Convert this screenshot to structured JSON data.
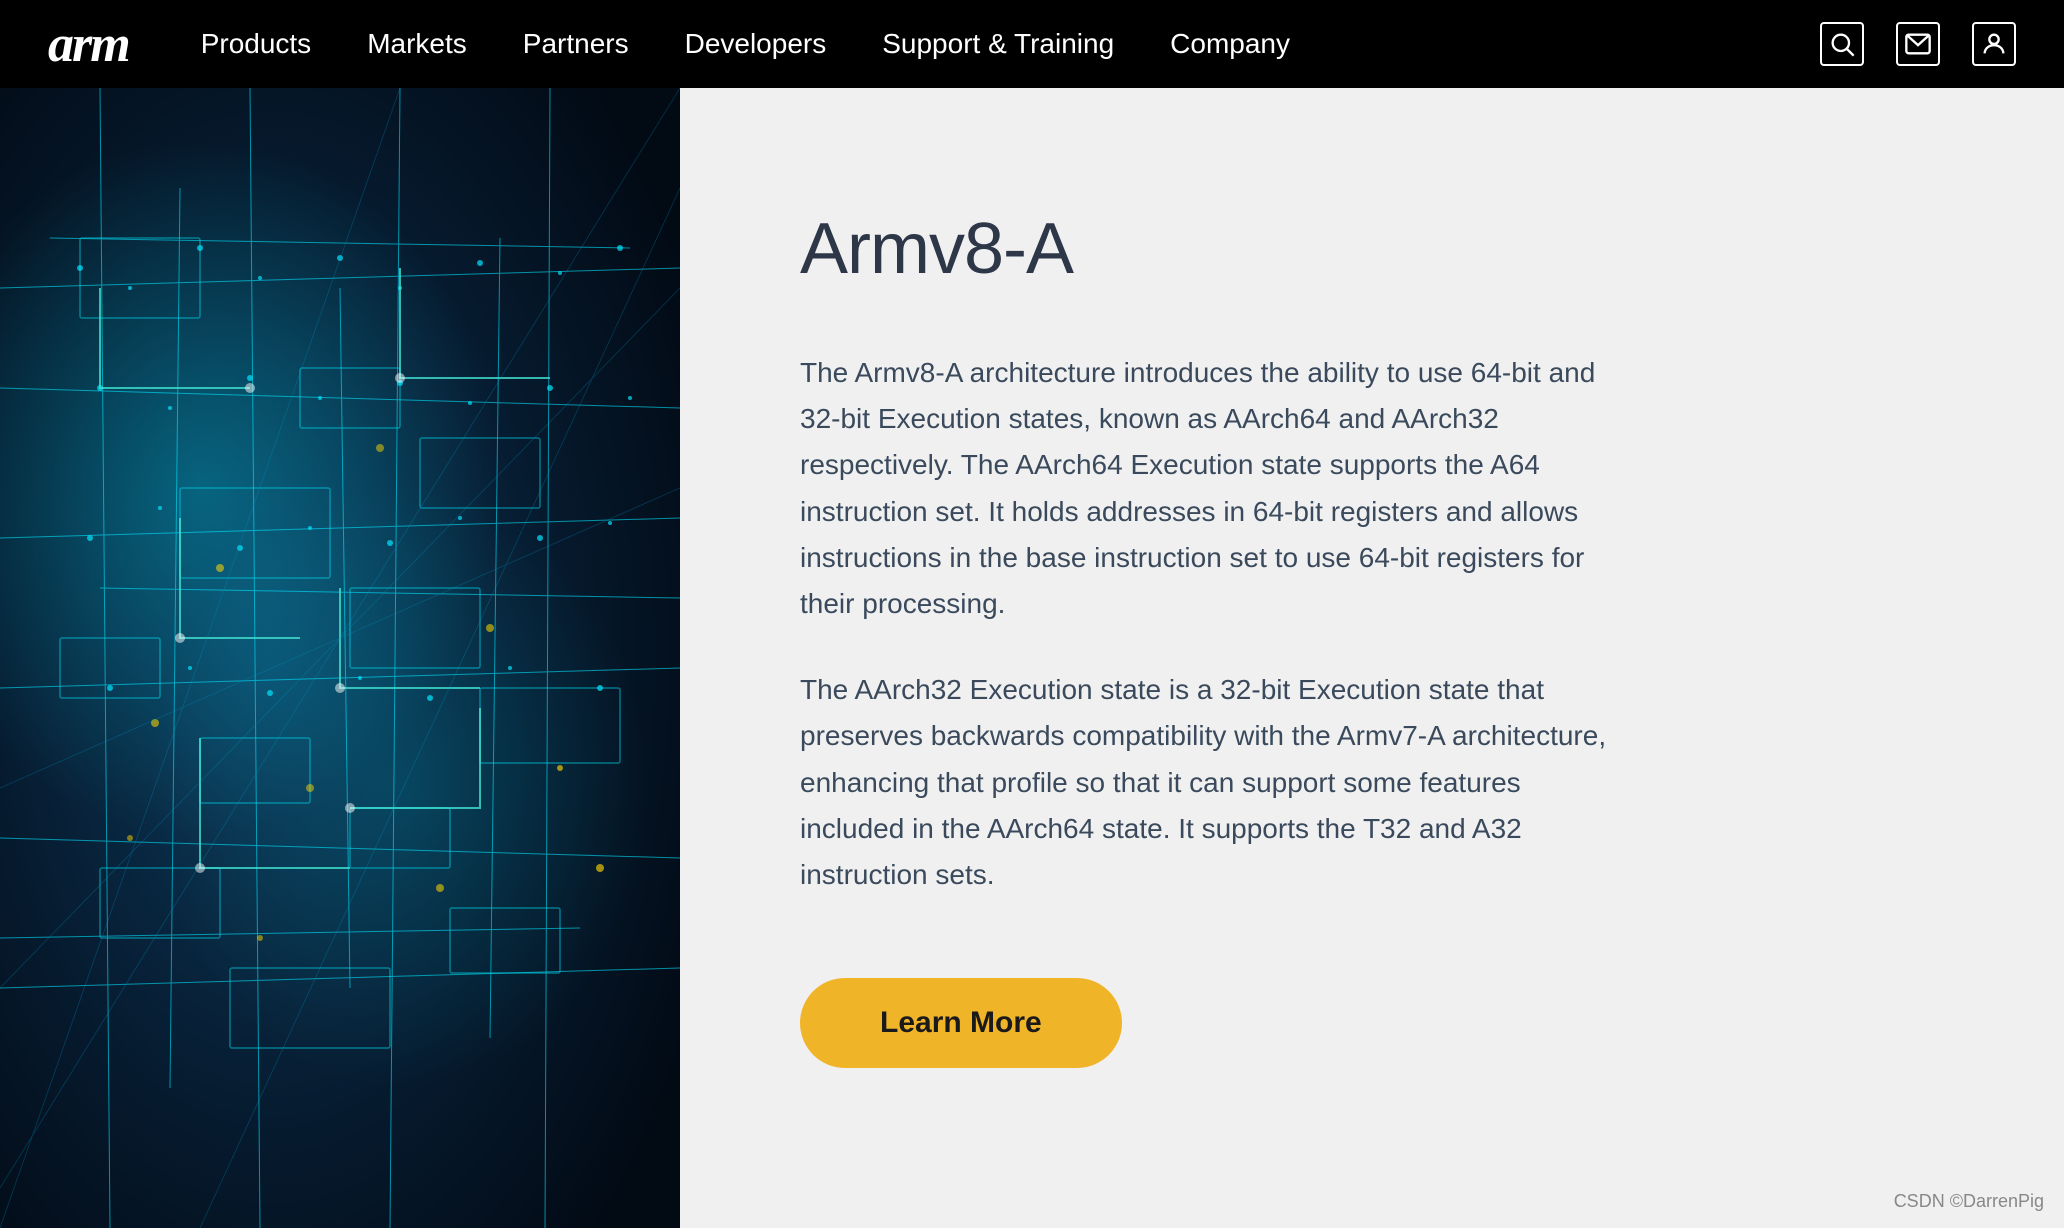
{
  "header": {
    "logo": "arm",
    "nav_items": [
      {
        "label": "Products",
        "id": "products"
      },
      {
        "label": "Markets",
        "id": "markets"
      },
      {
        "label": "Partners",
        "id": "partners"
      },
      {
        "label": "Developers",
        "id": "developers"
      },
      {
        "label": "Support & Training",
        "id": "support-training"
      },
      {
        "label": "Company",
        "id": "company"
      }
    ],
    "icons": [
      {
        "name": "search-icon",
        "title": "Search"
      },
      {
        "name": "mail-icon",
        "title": "Mail"
      },
      {
        "name": "user-icon",
        "title": "Account"
      }
    ]
  },
  "content": {
    "title": "Armv8-A",
    "paragraph1": "The Armv8-A architecture introduces the ability to use 64-bit and 32-bit Execution states, known as AArch64 and AArch32 respectively. The AArch64 Execution state supports the A64 instruction set. It holds addresses in 64-bit registers and allows instructions in the base instruction set to use 64-bit registers for their processing.",
    "paragraph2": "The AArch32 Execution state is a 32-bit Execution state that preserves backwards compatibility with the Armv7-A architecture, enhancing that profile so that it can support some features included in the AArch64 state. It supports the T32 and A32 instruction sets.",
    "learn_more_label": "Learn More"
  },
  "watermark": "CSDN ©DarrenPig",
  "colors": {
    "header_bg": "#000000",
    "content_bg": "#f0f0f0",
    "button_bg": "#f0b429",
    "title_color": "#2d3748",
    "text_color": "#3a4a5c"
  }
}
